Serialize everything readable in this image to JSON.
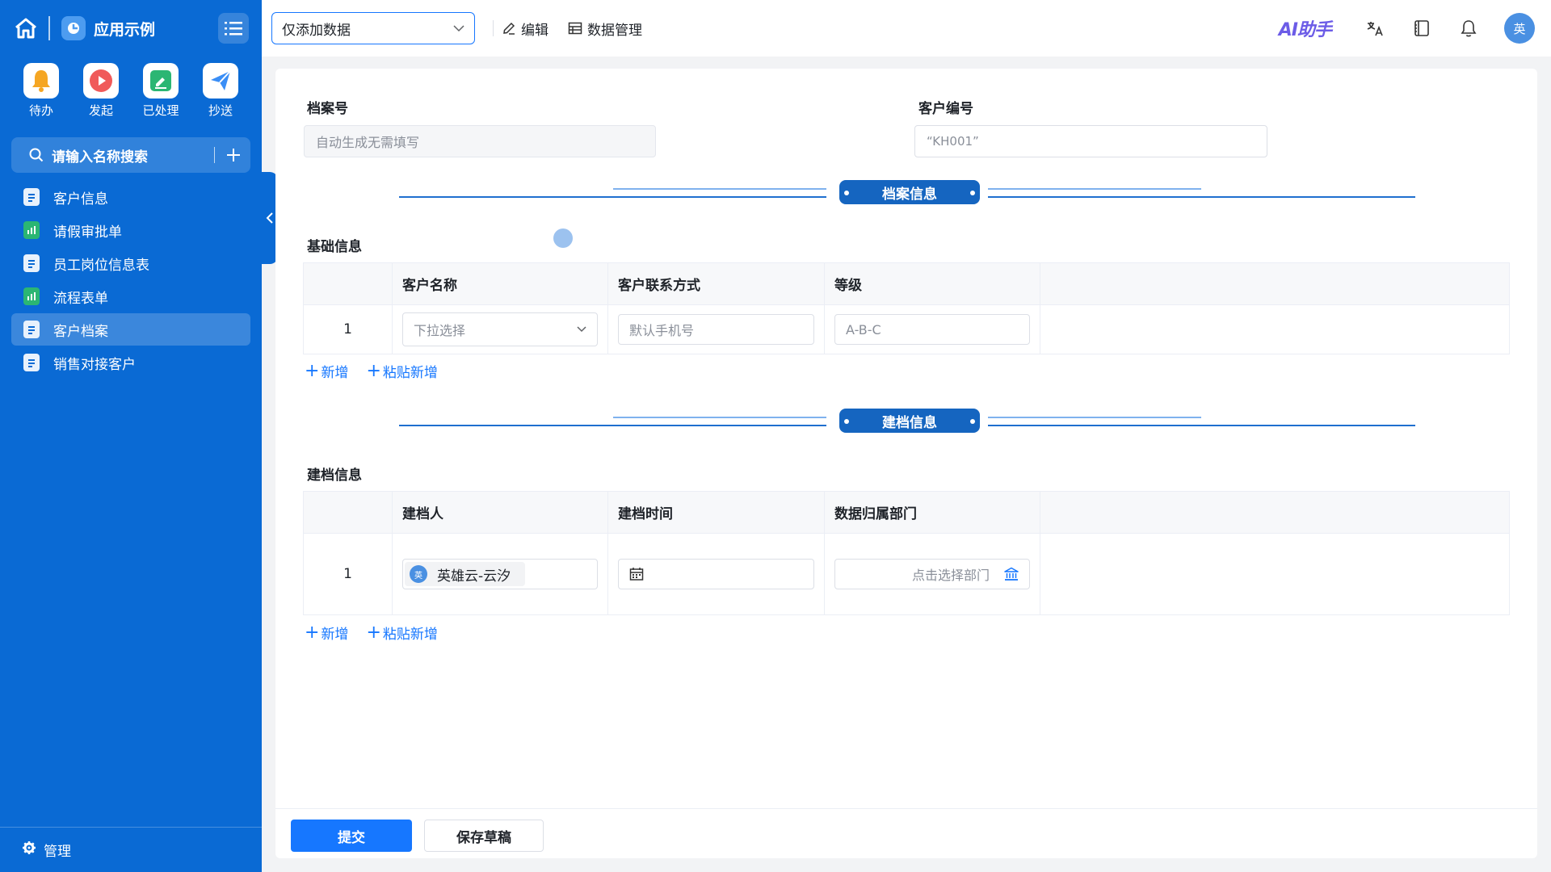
{
  "sidebar": {
    "app_name": "应用示例",
    "quick": [
      {
        "label": "待办",
        "icon": "bell-icon",
        "color": "#f5a623"
      },
      {
        "label": "发起",
        "icon": "play-icon",
        "color": "#f05a5a"
      },
      {
        "label": "已处理",
        "icon": "check-edit-icon",
        "color": "#2bb673"
      },
      {
        "label": "抄送",
        "icon": "send-icon",
        "color": "#3a8ef6"
      }
    ],
    "search_placeholder": "请输入名称搜索",
    "nav": [
      {
        "label": "客户信息",
        "icon": "document-icon"
      },
      {
        "label": "请假审批单",
        "icon": "chart-icon"
      },
      {
        "label": "员工岗位信息表",
        "icon": "document-icon"
      },
      {
        "label": "流程表单",
        "icon": "chart-icon"
      },
      {
        "label": "客户档案",
        "icon": "document-icon",
        "active": true
      },
      {
        "label": "销售对接客户",
        "icon": "document-icon"
      }
    ],
    "manage": "管理"
  },
  "topbar": {
    "view_select": "仅添加数据",
    "edit": "编辑",
    "data_manage": "数据管理",
    "ai": "AI助手",
    "avatar": "英"
  },
  "form": {
    "archive_no_label": "档案号",
    "archive_no_placeholder": "自动生成无需填写",
    "customer_no_label": "客户编号",
    "customer_no_value": "“KH001”",
    "section1": "档案信息",
    "basic_title": "基础信息",
    "basic_columns": [
      "客户名称",
      "客户联系方式",
      "等级"
    ],
    "basic_row": {
      "index": "1",
      "name_placeholder": "下拉选择",
      "phone_placeholder": "默认手机号",
      "level_placeholder": "A-B-C"
    },
    "add": "新增",
    "paste_add": "粘贴新增",
    "section2": "建档信息",
    "archive_title": "建档信息",
    "archive_columns": [
      "建档人",
      "建档时间",
      "数据归属部门"
    ],
    "archive_row": {
      "index": "1",
      "user_avatar": "英",
      "user": "英雄云-云汐",
      "dept_placeholder": "点击选择部门"
    },
    "submit": "提交",
    "save_draft": "保存草稿"
  }
}
